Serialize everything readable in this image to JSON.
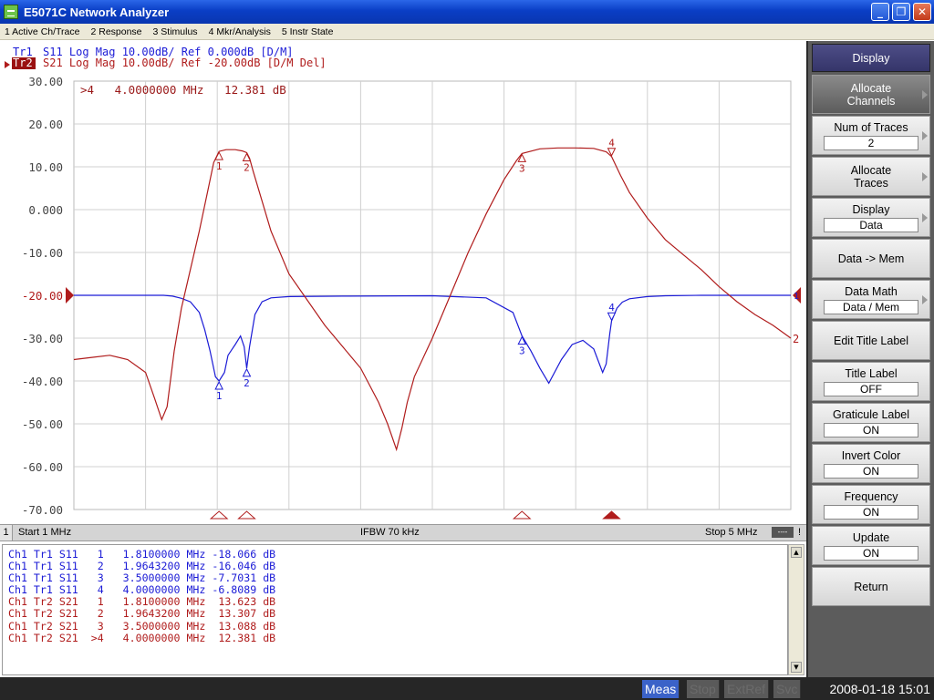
{
  "window": {
    "title": "E5071C Network Analyzer"
  },
  "menu": [
    "1 Active Ch/Trace",
    "2 Response",
    "3 Stimulus",
    "4 Mkr/Analysis",
    "5 Instr State"
  ],
  "traces": {
    "tr1": {
      "label": "Tr1",
      "text": "S11 Log Mag 10.00dB/ Ref 0.000dB [D/M]",
      "color": "#1b1bd6"
    },
    "tr2": {
      "label": "Tr2",
      "text": "S21 Log Mag 10.00dB/ Ref -20.00dB [D/M Del]",
      "color": "#b01c1c"
    }
  },
  "active_marker_readout": ">4   4.0000000 MHz   12.381 dB",
  "trace_end_label": "2",
  "ref_line_right_label": "1",
  "chart_data": {
    "type": "line",
    "x_range": [
      1,
      5
    ],
    "x_unit": "MHz",
    "ylim": [
      -70,
      30
    ],
    "y_ticks": [
      "30.00",
      "20.00",
      "10.00",
      "0.000",
      "-10.00",
      "-20.00",
      "-30.00",
      "-40.00",
      "-50.00",
      "-60.00",
      "-70.00"
    ],
    "grid": true,
    "series": [
      {
        "name": "Tr1 S11",
        "color": "#1b1bd6",
        "x": [
          1.0,
          1.5,
          1.55,
          1.6,
          1.65,
          1.7,
          1.73,
          1.76,
          1.79,
          1.81,
          1.84,
          1.86,
          1.9,
          1.93,
          1.95,
          1.9643,
          1.98,
          2.01,
          2.05,
          2.1,
          2.2,
          2.5,
          3.0,
          3.3,
          3.45,
          3.5,
          3.55,
          3.6,
          3.65,
          3.72,
          3.78,
          3.84,
          3.9,
          3.95,
          3.97,
          3.99,
          4.0,
          4.03,
          4.06,
          4.1,
          4.2,
          4.3,
          4.5,
          5.0
        ],
        "y": [
          -20.0,
          -20.0,
          -20.2,
          -20.7,
          -21.5,
          -24.0,
          -28.0,
          -33.0,
          -39.0,
          -40.0,
          -38.0,
          -34.0,
          -31.5,
          -29.5,
          -32.0,
          -37.0,
          -32.0,
          -24.5,
          -21.5,
          -20.6,
          -20.3,
          -20.2,
          -20.1,
          -20.6,
          -24.0,
          -29.5,
          -33.0,
          -37.0,
          -40.5,
          -35.0,
          -31.5,
          -30.5,
          -32.5,
          -38.0,
          -36.0,
          -29.0,
          -26.0,
          -23.0,
          -21.6,
          -20.8,
          -20.3,
          -20.1,
          -20.0,
          -20.0
        ]
      },
      {
        "name": "Tr2 S21",
        "color": "#b01c1c",
        "x": [
          1.0,
          1.1,
          1.2,
          1.3,
          1.4,
          1.45,
          1.49,
          1.52,
          1.56,
          1.6,
          1.7,
          1.75,
          1.78,
          1.81,
          1.85,
          1.9,
          1.94,
          1.9643,
          1.98,
          2.0,
          2.05,
          2.1,
          2.2,
          2.4,
          2.6,
          2.7,
          2.75,
          2.8,
          2.83,
          2.86,
          2.9,
          3.0,
          3.1,
          3.2,
          3.3,
          3.4,
          3.47,
          3.5,
          3.6,
          3.7,
          3.8,
          3.9,
          3.97,
          4.0,
          4.05,
          4.1,
          4.2,
          4.3,
          4.4,
          4.5,
          4.6,
          4.7,
          4.8,
          4.9,
          5.0
        ],
        "y": [
          -35.0,
          -34.5,
          -34.0,
          -35.0,
          -38.0,
          -44.0,
          -49.0,
          -46.0,
          -33.0,
          -23.0,
          -5.0,
          5.0,
          11.0,
          13.6,
          14.0,
          14.0,
          13.7,
          13.3,
          12.0,
          9.0,
          2.0,
          -5.0,
          -15.0,
          -27.0,
          -37.0,
          -45.0,
          -50.0,
          -56.0,
          -51.0,
          -45.0,
          -39.0,
          -30.0,
          -20.0,
          -10.0,
          -1.0,
          7.0,
          11.5,
          13.1,
          14.2,
          14.4,
          14.4,
          14.3,
          13.5,
          12.4,
          8.0,
          4.0,
          -2.0,
          -7.0,
          -10.5,
          -14.0,
          -18.0,
          -21.5,
          -24.5,
          -27.0,
          -30.0
        ]
      }
    ],
    "markers": [
      {
        "series": "Tr1 S11",
        "id": "1",
        "x": 1.81,
        "y": -40.0
      },
      {
        "series": "Tr1 S11",
        "id": "2",
        "x": 1.9643,
        "y": -37.0
      },
      {
        "series": "Tr1 S11",
        "id": "3",
        "x": 3.5,
        "y": -29.5
      },
      {
        "series": "Tr1 S11",
        "id": "4",
        "x": 4.0,
        "y": -26.0
      },
      {
        "series": "Tr2 S21",
        "id": "1",
        "x": 1.81,
        "y": 13.6
      },
      {
        "series": "Tr2 S21",
        "id": "2",
        "x": 1.9643,
        "y": 13.3
      },
      {
        "series": "Tr2 S21",
        "id": "3",
        "x": 3.5,
        "y": 13.1
      },
      {
        "series": "Tr2 S21",
        "id": "4",
        "x": 4.0,
        "y": 12.4
      }
    ],
    "bottom_markers_x": [
      1.81,
      1.9643,
      3.5,
      4.0
    ],
    "active_bottom_marker_x": 4.0,
    "ref_level": -20
  },
  "status": {
    "ch": "1",
    "start": "Start 1 MHz",
    "ifbw": "IFBW 70 kHz",
    "stop": "Stop 5 MHz",
    "chip": "----",
    "excl": "!"
  },
  "marker_table": [
    "Ch1 Tr1 S11   1   1.8100000 MHz -18.066 dB",
    "Ch1 Tr1 S11   2   1.9643200 MHz -16.046 dB",
    "Ch1 Tr1 S11   3   3.5000000 MHz -7.7031 dB",
    "Ch1 Tr1 S11   4   4.0000000 MHz -6.8089 dB",
    "Ch1 Tr2 S21   1   1.8100000 MHz  13.623 dB",
    "Ch1 Tr2 S21   2   1.9643200 MHz  13.307 dB",
    "Ch1 Tr2 S21   3   3.5000000 MHz  13.088 dB",
    "Ch1 Tr2 S21  >4   4.0000000 MHz  12.381 dB"
  ],
  "softkeys": {
    "display": "Display",
    "allocate_channels": [
      "Allocate",
      "Channels"
    ],
    "num_traces": {
      "label": "Num of Traces",
      "value": "2"
    },
    "allocate_traces": [
      "Allocate",
      "Traces"
    ],
    "display_data": {
      "label": "Display",
      "value": "Data"
    },
    "data_mem": "Data -> Mem",
    "data_math": {
      "label": "Data Math",
      "value": "Data / Mem"
    },
    "edit_title": "Edit Title Label",
    "title_label": {
      "label": "Title Label",
      "value": "OFF"
    },
    "graticule": {
      "label": "Graticule Label",
      "value": "ON"
    },
    "invert": {
      "label": "Invert Color",
      "value": "ON"
    },
    "frequency": {
      "label": "Frequency",
      "value": "ON"
    },
    "update": {
      "label": "Update",
      "value": "ON"
    },
    "return": "Return"
  },
  "bottom": {
    "meas": "Meas",
    "stop": "Stop",
    "extref": "ExtRef",
    "svc": "Svc",
    "datetime": "2008-01-18 15:01"
  }
}
